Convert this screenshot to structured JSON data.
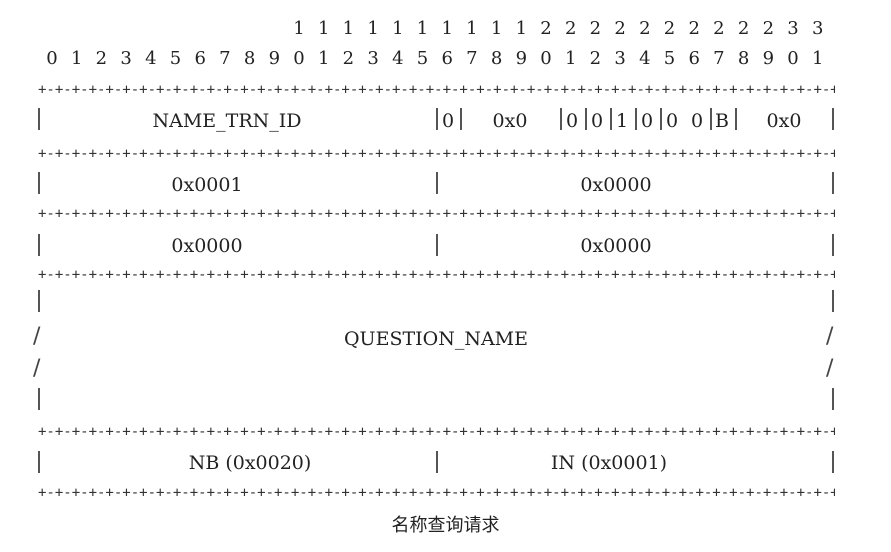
{
  "bit_ruler": {
    "tens": [
      "",
      "",
      "",
      "",
      "",
      "",
      "",
      "",
      "",
      "",
      "1",
      "1",
      "1",
      "1",
      "1",
      "1",
      "1",
      "1",
      "1",
      "1",
      "2",
      "2",
      "2",
      "2",
      "2",
      "2",
      "2",
      "2",
      "2",
      "2",
      "3",
      "3"
    ],
    "ones": [
      "0",
      "1",
      "2",
      "3",
      "4",
      "5",
      "6",
      "7",
      "8",
      "9",
      "0",
      "1",
      "2",
      "3",
      "4",
      "5",
      "6",
      "7",
      "8",
      "9",
      "0",
      "1",
      "2",
      "3",
      "4",
      "5",
      "6",
      "7",
      "8",
      "9",
      "0",
      "1"
    ]
  },
  "rows": {
    "header": {
      "name_trn_id": "NAME_TRN_ID",
      "r": "0",
      "opcode": "0x0",
      "aa": "0",
      "tc": "0",
      "rd": "1",
      "ra": "0",
      "z1": "0",
      "z2": "0",
      "b": "B",
      "rcode": "0x0"
    },
    "counts1": {
      "qdcount": "0x0001",
      "ancount": "0x0000"
    },
    "counts2": {
      "nscount": "0x0000",
      "arcount": "0x0000"
    },
    "question": {
      "name": "QUESTION_NAME"
    },
    "type_class": {
      "type": "NB (0x0020)",
      "class": "IN (0x0001)"
    }
  },
  "caption": "名称查询请求"
}
